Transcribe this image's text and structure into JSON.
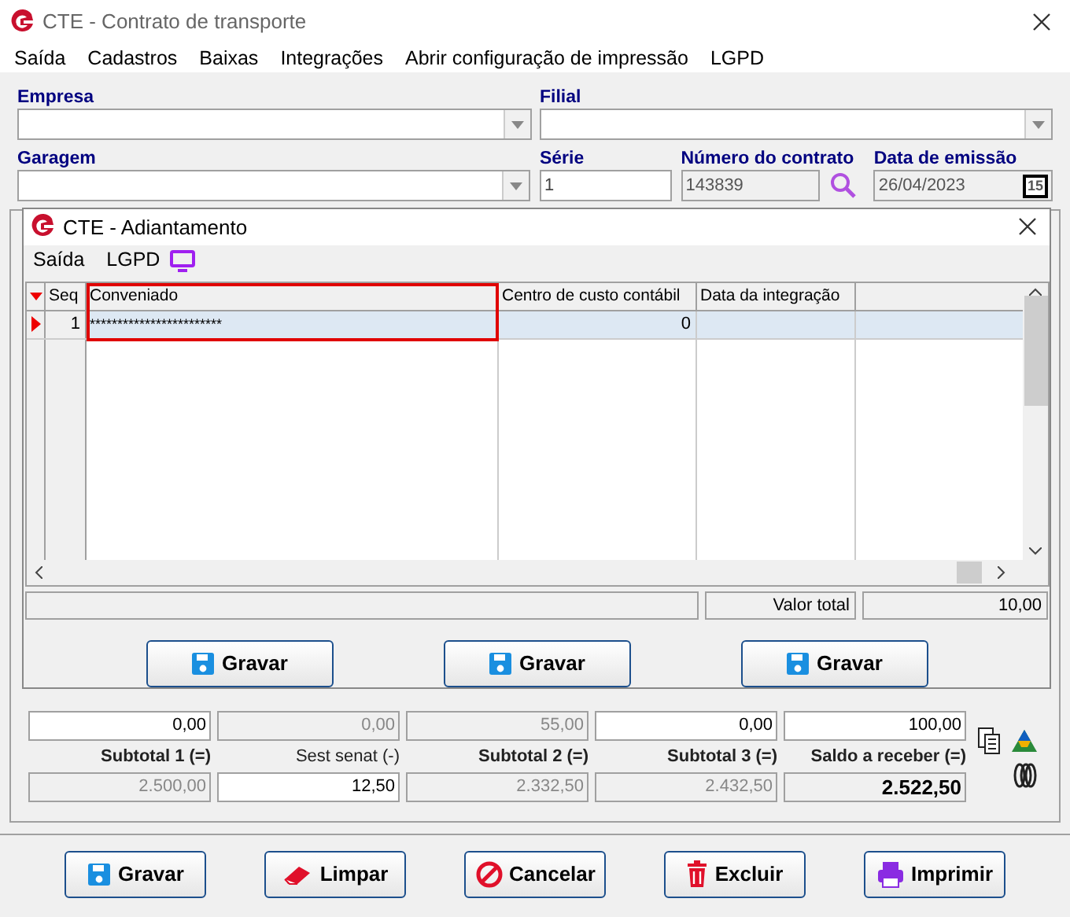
{
  "window": {
    "title": "CTE - Contrato de transporte"
  },
  "menu": [
    "Saída",
    "Cadastros",
    "Baixas",
    "Integrações",
    "Abrir configuração de impressão",
    "LGPD"
  ],
  "header": {
    "empresa": {
      "label": "Empresa"
    },
    "filial": {
      "label": "Filial"
    },
    "garagem": {
      "label": "Garagem"
    },
    "serie": {
      "label": "Série",
      "value": "1"
    },
    "numero": {
      "label": "Número do contrato",
      "value": "143839"
    },
    "data": {
      "label": "Data de emissão",
      "value": "26/04/2023",
      "calendar": "15"
    }
  },
  "dialog": {
    "title": "CTE - Adiantamento",
    "menu": [
      "Saída",
      "LGPD"
    ],
    "table": {
      "columns": [
        "Seq",
        "Conveniado",
        "Centro de custo contábil",
        "Data da integração"
      ],
      "rows": [
        {
          "seq": "1",
          "conveniado": "************************",
          "centro": "0",
          "selected": true
        }
      ]
    },
    "total_label": "Valor total",
    "total_value": "10,00",
    "buttons": [
      "Gravar",
      "Gravar",
      "Gravar"
    ]
  },
  "values_row": [
    {
      "value": "0,00",
      "disabled": false
    },
    {
      "value": "0,00",
      "disabled": true
    },
    {
      "value": "55,00",
      "disabled": true
    },
    {
      "value": "0,00",
      "disabled": false
    },
    {
      "value": "100,00",
      "disabled": false
    }
  ],
  "subtotals": [
    {
      "label": "Subtotal 1 (=)",
      "bold": true,
      "value": "2.500,00",
      "disabled": true
    },
    {
      "label": "Sest senat (-)",
      "bold": false,
      "value": "12,50",
      "disabled": false
    },
    {
      "label": "Subtotal 2 (=)",
      "bold": true,
      "value": "2.332,50",
      "disabled": true
    },
    {
      "label": "Subtotal 3 (=)",
      "bold": true,
      "value": "2.432,50",
      "disabled": true
    },
    {
      "label": "Saldo a receber (=)",
      "bold": true,
      "value": "2.522,50",
      "disabled": true,
      "strong": true
    }
  ],
  "buttons": [
    {
      "label": "Gravar",
      "kind": "save"
    },
    {
      "label": "Limpar",
      "kind": "clear"
    },
    {
      "label": "Cancelar",
      "kind": "cancel"
    },
    {
      "label": "Excluir",
      "kind": "delete"
    },
    {
      "label": "Imprimir",
      "kind": "print"
    }
  ]
}
